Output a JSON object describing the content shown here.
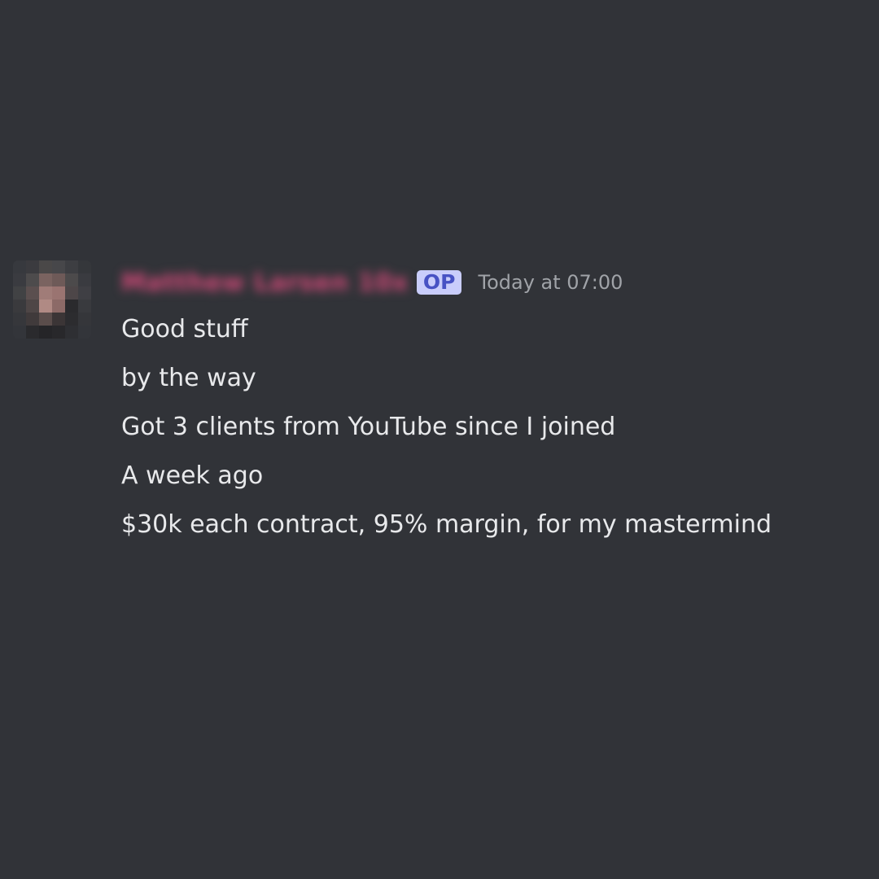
{
  "message": {
    "author": {
      "name": "Matthew Larsen 10x",
      "name_color": "#d24a79",
      "avatar": "pixelated-avatar"
    },
    "badge": "OP",
    "timestamp": "Today at 07:00",
    "lines": [
      "Good stuff",
      "by the way",
      "Got 3 clients from YouTube since I joined",
      "A week ago",
      "$30k each contract, 95% margin, for my mastermind"
    ]
  },
  "colors": {
    "background": "#313338",
    "badge_bg": "#c9cdfb",
    "badge_text": "#4752c4",
    "timestamp": "#a0a3a8",
    "text": "#e8e9eb"
  }
}
